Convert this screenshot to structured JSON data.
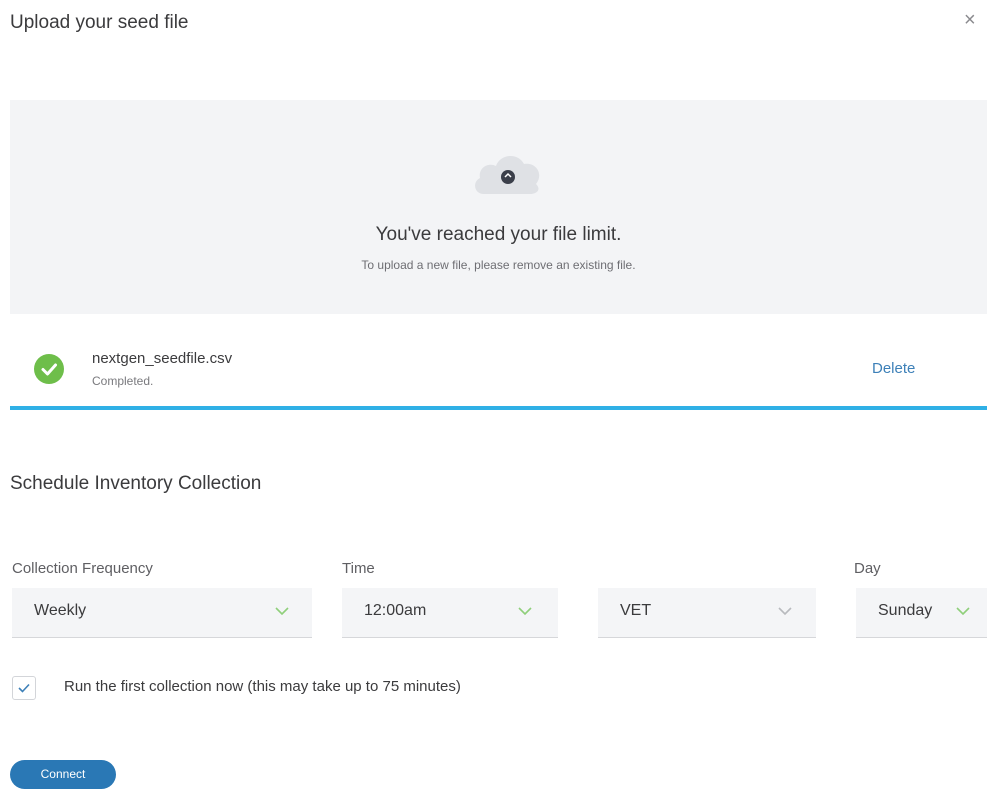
{
  "dialog": {
    "title": "Upload your seed file",
    "close_glyph": "×"
  },
  "dropzone": {
    "icon": "cloud-upload-icon",
    "title": "You've reached your file limit.",
    "subtitle": "To upload a new file, please remove an existing file."
  },
  "file": {
    "name": "nextgen_seedfile.csv",
    "status": "Completed.",
    "delete_label": "Delete",
    "progress": 1.0,
    "status_icon": "check-circle-icon"
  },
  "schedule": {
    "title": "Schedule Inventory Collection",
    "frequency": {
      "label": "Collection Frequency",
      "value": "Weekly"
    },
    "time": {
      "label": "Time",
      "value": "12:00am"
    },
    "timezone": {
      "value": "VET"
    },
    "day": {
      "label": "Day",
      "value": "Sunday"
    },
    "run_now": {
      "checked": true,
      "label": "Run the first collection now (this may take up to 75 minutes)"
    }
  },
  "actions": {
    "connect_label": "Connect"
  },
  "colors": {
    "accent": "#2a78b5",
    "link": "#3d80b8",
    "success": "#6ebe4a",
    "progress": "#2fb0e6",
    "chevron": "#8fcf7a"
  }
}
